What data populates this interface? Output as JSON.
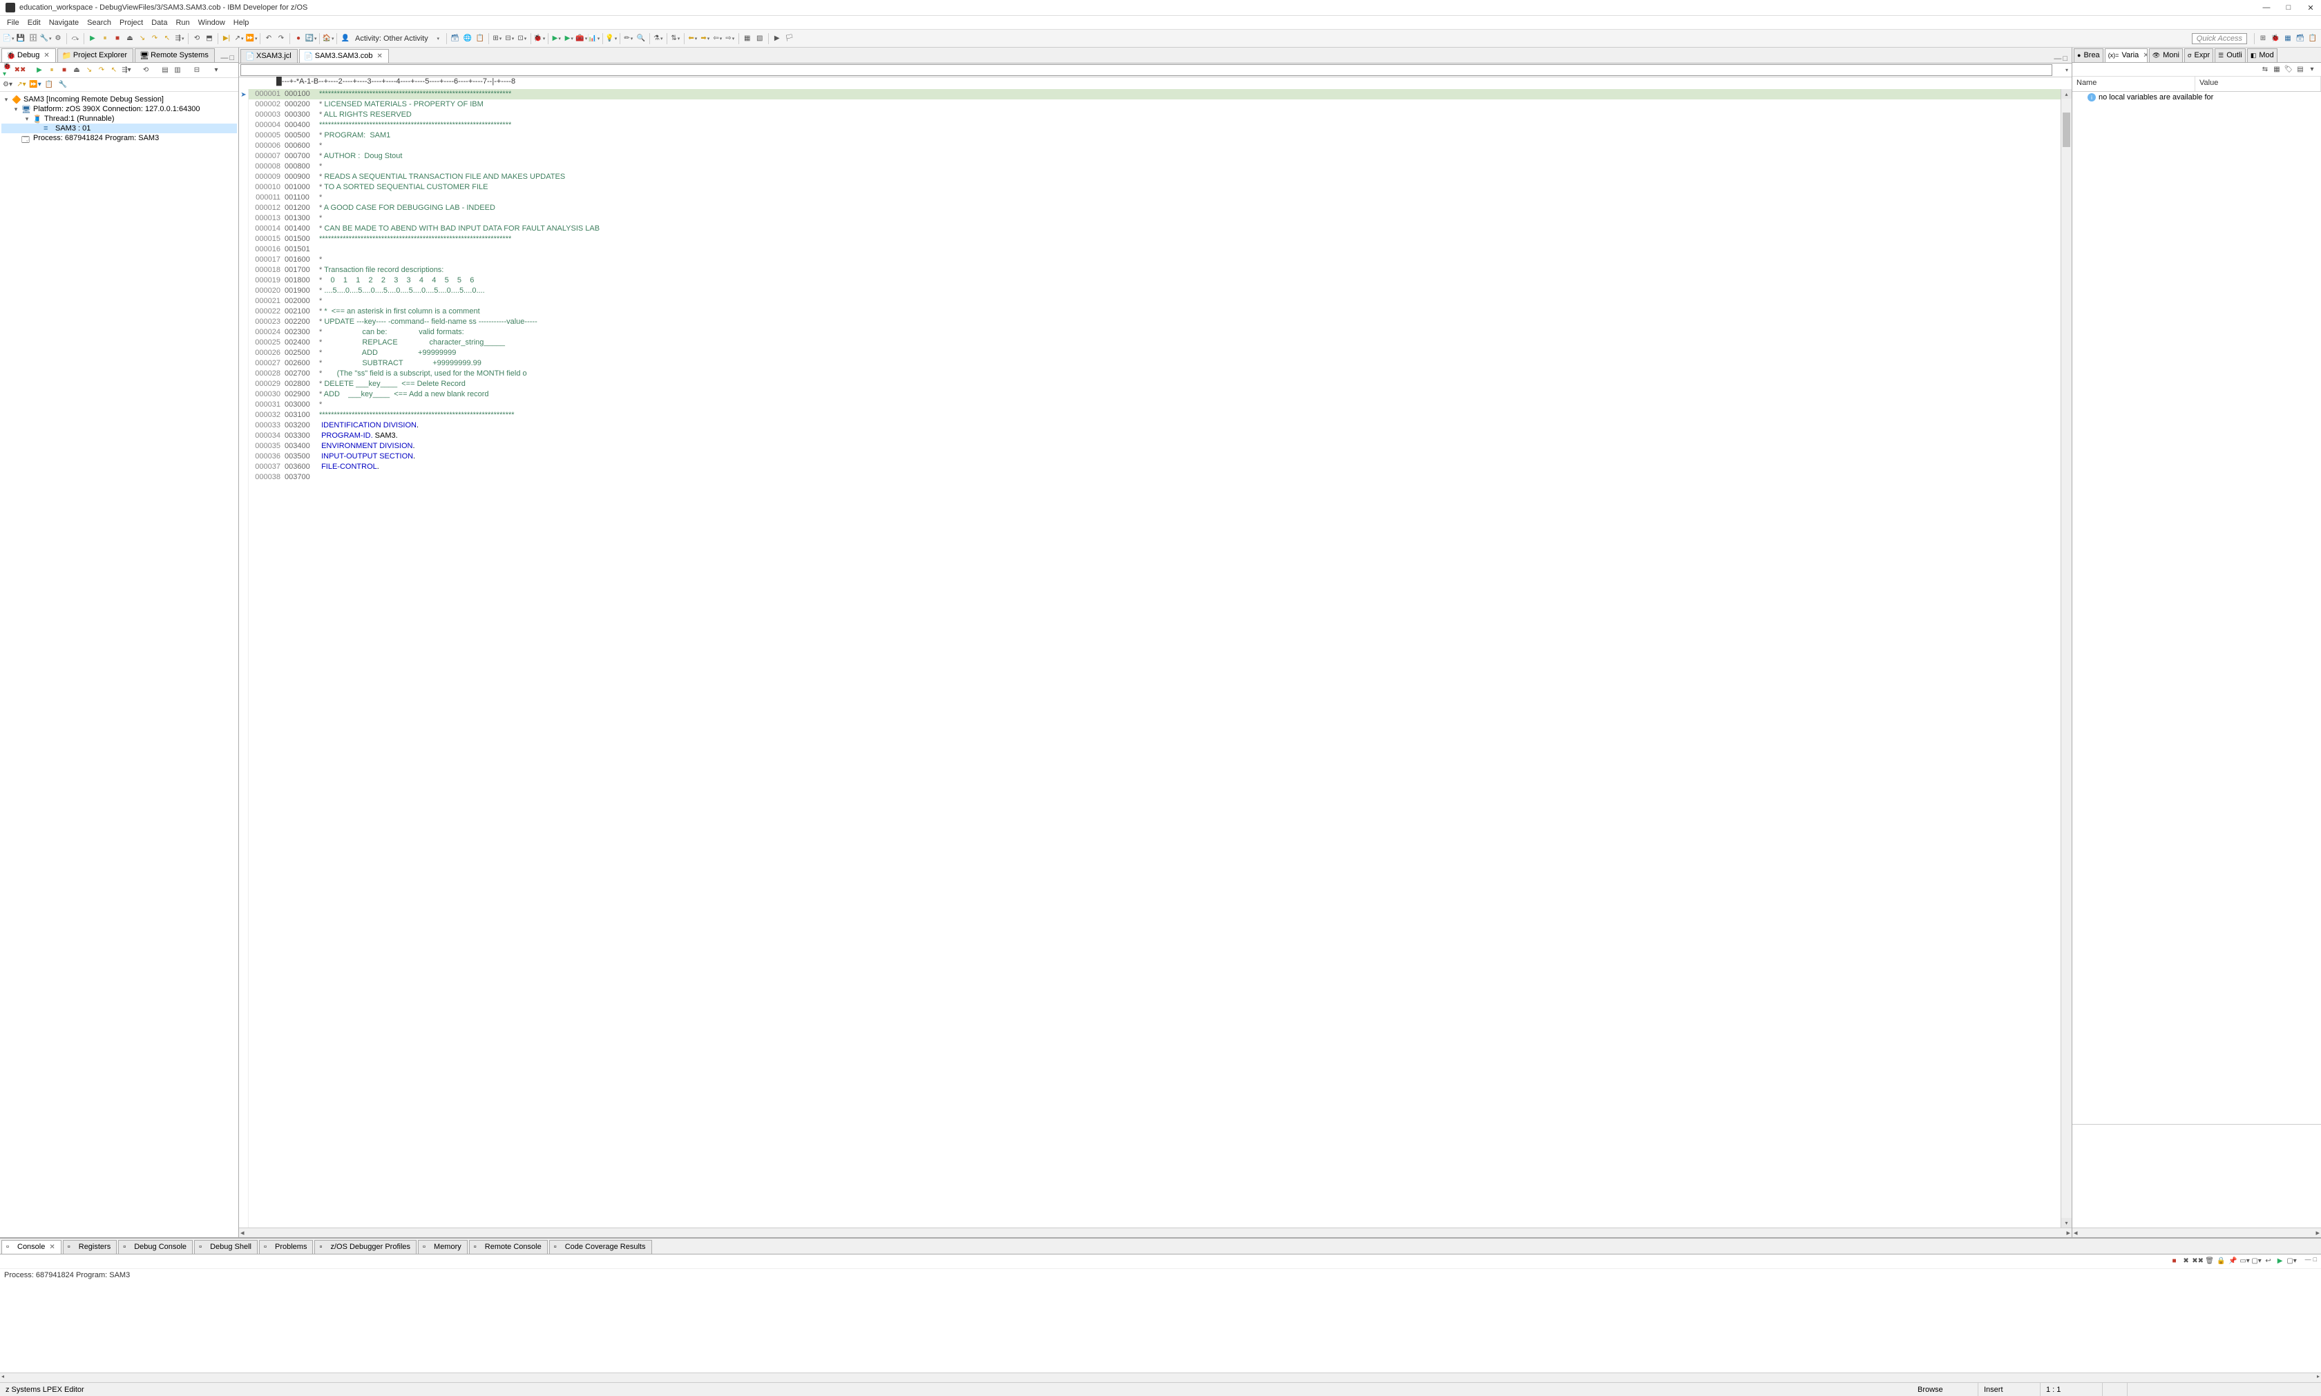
{
  "window": {
    "title": "education_workspace - DebugViewFiles/3/SAM3.SAM3.cob - IBM Developer for z/OS",
    "minimize": "—",
    "maximize": "□",
    "close": "✕"
  },
  "menu": [
    "File",
    "Edit",
    "Navigate",
    "Search",
    "Project",
    "Data",
    "Run",
    "Window",
    "Help"
  ],
  "toolbar": {
    "activity_label": "Activity:",
    "activity_value": "Other Activity",
    "quick_access": "Quick Access"
  },
  "left_tabs": [
    {
      "label": "Debug",
      "active": true,
      "icon": "bug"
    },
    {
      "label": "Project Explorer",
      "active": false,
      "icon": "folder"
    },
    {
      "label": "Remote Systems",
      "active": false,
      "icon": "remote"
    }
  ],
  "debug_tree": {
    "root": "SAM3 [Incoming Remote Debug Session]",
    "platform": "Platform: zOS 390X   Connection: 127.0.0.1:64300",
    "thread": "Thread:1 (Runnable)",
    "frame": "SAM3 : 01",
    "process": "Process: 687941824  Program: SAM3"
  },
  "editor_tabs": [
    {
      "label": "XSAM3.jcl",
      "active": false
    },
    {
      "label": "SAM3.SAM3.cob",
      "active": true
    }
  ],
  "ruler": "█---+-*A-1-B--+----2----+----3----+----4----+----5----+----6----+----7--|-+----8",
  "code_lines": [
    {
      "ln": "000001",
      "sq": "000100",
      "type": "stars",
      "txt": "****************************************************************",
      "hl": true
    },
    {
      "ln": "000002",
      "sq": "000200",
      "type": "comment",
      "txt": " LICENSED MATERIALS - PROPERTY OF IBM"
    },
    {
      "ln": "000003",
      "sq": "000300",
      "type": "comment",
      "txt": " ALL RIGHTS RESERVED"
    },
    {
      "ln": "000004",
      "sq": "000400",
      "type": "stars",
      "txt": "****************************************************************"
    },
    {
      "ln": "000005",
      "sq": "000500",
      "type": "comment",
      "txt": " PROGRAM:  SAM1"
    },
    {
      "ln": "000006",
      "sq": "000600",
      "type": "comment",
      "txt": ""
    },
    {
      "ln": "000007",
      "sq": "000700",
      "type": "comment",
      "txt": " AUTHOR :  Doug Stout"
    },
    {
      "ln": "000008",
      "sq": "000800",
      "type": "comment",
      "txt": ""
    },
    {
      "ln": "000009",
      "sq": "000900",
      "type": "comment",
      "txt": " READS A SEQUENTIAL TRANSACTION FILE AND MAKES UPDATES"
    },
    {
      "ln": "000010",
      "sq": "001000",
      "type": "comment",
      "txt": " TO A SORTED SEQUENTIAL CUSTOMER FILE"
    },
    {
      "ln": "000011",
      "sq": "001100",
      "type": "comment",
      "txt": ""
    },
    {
      "ln": "000012",
      "sq": "001200",
      "type": "comment",
      "txt": " A GOOD CASE FOR DEBUGGING LAB - INDEED"
    },
    {
      "ln": "000013",
      "sq": "001300",
      "type": "comment",
      "txt": ""
    },
    {
      "ln": "000014",
      "sq": "001400",
      "type": "comment",
      "txt": " CAN BE MADE TO ABEND WITH BAD INPUT DATA FOR FAULT ANALYSIS LAB"
    },
    {
      "ln": "000015",
      "sq": "001500",
      "type": "stars",
      "txt": "****************************************************************"
    },
    {
      "ln": "000016",
      "sq": "001501",
      "type": "blank",
      "txt": ""
    },
    {
      "ln": "000017",
      "sq": "001600",
      "type": "comment",
      "txt": ""
    },
    {
      "ln": "000018",
      "sq": "001700",
      "type": "comment",
      "txt": " Transaction file record descriptions:"
    },
    {
      "ln": "000019",
      "sq": "001800",
      "type": "comment",
      "txt": "    0    1    1    2    2    3    3    4    4    5    5    6"
    },
    {
      "ln": "000020",
      "sq": "001900",
      "type": "comment",
      "txt": " ....5....0....5....0....5....0....5....0....5....0....5....0...."
    },
    {
      "ln": "000021",
      "sq": "002000",
      "type": "comment",
      "txt": ""
    },
    {
      "ln": "000022",
      "sq": "002100",
      "type": "comment",
      "txt": " *  <== an asterisk in first column is a comment"
    },
    {
      "ln": "000023",
      "sq": "002200",
      "type": "comment",
      "txt": " UPDATE ---key---- -command-- field-name ss -----------value-----"
    },
    {
      "ln": "000024",
      "sq": "002300",
      "type": "comment",
      "txt": "                   can be:               valid formats:"
    },
    {
      "ln": "000025",
      "sq": "002400",
      "type": "comment",
      "txt": "                   REPLACE               character_string_____"
    },
    {
      "ln": "000026",
      "sq": "002500",
      "type": "comment",
      "txt": "                   ADD                   +99999999"
    },
    {
      "ln": "000027",
      "sq": "002600",
      "type": "comment",
      "txt": "                   SUBTRACT              +99999999.99"
    },
    {
      "ln": "000028",
      "sq": "002700",
      "type": "comment",
      "txt": "       (The \"ss\" field is a subscript, used for the MONTH field o"
    },
    {
      "ln": "000029",
      "sq": "002800",
      "type": "comment",
      "txt": " DELETE ___key____  <== Delete Record"
    },
    {
      "ln": "000030",
      "sq": "002900",
      "type": "comment",
      "txt": " ADD    ___key____  <== Add a new blank record"
    },
    {
      "ln": "000031",
      "sq": "003000",
      "type": "comment",
      "txt": ""
    },
    {
      "ln": "000032",
      "sq": "003100",
      "type": "stars",
      "txt": "*****************************************************************"
    },
    {
      "ln": "000033",
      "sq": "003200",
      "type": "code",
      "kw": "IDENTIFICATION DIVISION",
      "rest": "."
    },
    {
      "ln": "000034",
      "sq": "003300",
      "type": "code",
      "kw": "PROGRAM-ID.",
      "rest": " SAM3."
    },
    {
      "ln": "000035",
      "sq": "003400",
      "type": "code",
      "kw": "ENVIRONMENT DIVISION",
      "rest": "."
    },
    {
      "ln": "000036",
      "sq": "003500",
      "type": "code",
      "kw": "INPUT-OUTPUT SECTION",
      "rest": "."
    },
    {
      "ln": "000037",
      "sq": "003600",
      "type": "code",
      "kw": "FILE-CONTROL",
      "rest": "."
    },
    {
      "ln": "000038",
      "sq": "003700",
      "type": "blank",
      "txt": ""
    }
  ],
  "right_tabs": [
    {
      "label": "Brea",
      "icon": "●"
    },
    {
      "label": "Varia",
      "icon": "(x)=",
      "active": true
    },
    {
      "label": "Moni",
      "icon": "👁"
    },
    {
      "label": "Expr",
      "icon": "σ"
    },
    {
      "label": "Outli",
      "icon": "☰"
    },
    {
      "label": "Mod",
      "icon": "◧"
    }
  ],
  "variables": {
    "col_name": "Name",
    "col_value": "Value",
    "info_msg": "no local variables are available for"
  },
  "bottom_tabs": [
    {
      "label": "Console",
      "active": true
    },
    {
      "label": "Registers"
    },
    {
      "label": "Debug Console"
    },
    {
      "label": "Debug Shell"
    },
    {
      "label": "Problems"
    },
    {
      "label": "z/OS Debugger Profiles"
    },
    {
      "label": "Memory"
    },
    {
      "label": "Remote Console"
    },
    {
      "label": "Code Coverage Results"
    }
  ],
  "console": {
    "text": "Process: 687941824  Program: SAM3"
  },
  "status": {
    "editor": "z Systems LPEX Editor",
    "mode": "Browse",
    "insert": "Insert",
    "pos": "1 : 1"
  }
}
